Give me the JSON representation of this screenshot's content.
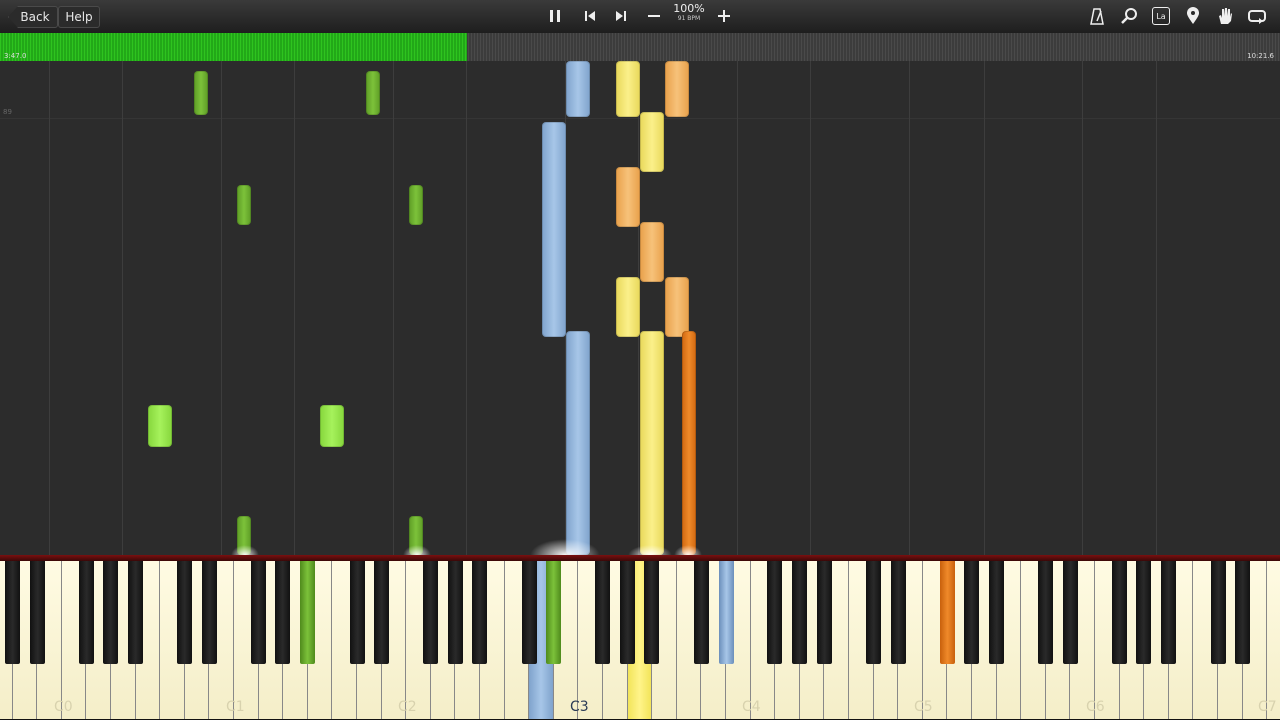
{
  "toolbar": {
    "back_label": "Back",
    "help_label": "Help",
    "icons": [
      "pause-icon",
      "previous-icon",
      "next-icon",
      "minus-icon",
      "plus-icon",
      "metronome-icon",
      "search-icon",
      "label-icon",
      "marker-icon",
      "hand-icon",
      "loop-icon"
    ],
    "label_icon_text": "La",
    "speed_percent": "100%",
    "speed_bpm": "91 BPM"
  },
  "progress": {
    "elapsed": "3:47.0",
    "total": "10:21.6",
    "fraction": 0.365,
    "color": "#2ec41f"
  },
  "roll": {
    "measure_numbers": [
      "89"
    ],
    "note_colors": {
      "left_hand_dark": "#7cc23a",
      "left_hand_light": "#a6f25c",
      "right_hand_blue": "#a7c6e8",
      "right_hand_yellow": "#fbf08a",
      "right_hand_orange_light": "#f7c27a",
      "right_hand_orange_dark": "#f08a2a"
    }
  },
  "keyboard": {
    "octave_labels": [
      "C0",
      "C1",
      "C2",
      "C3",
      "C4",
      "C5",
      "C6",
      "C7"
    ],
    "active_octave": "C3"
  }
}
